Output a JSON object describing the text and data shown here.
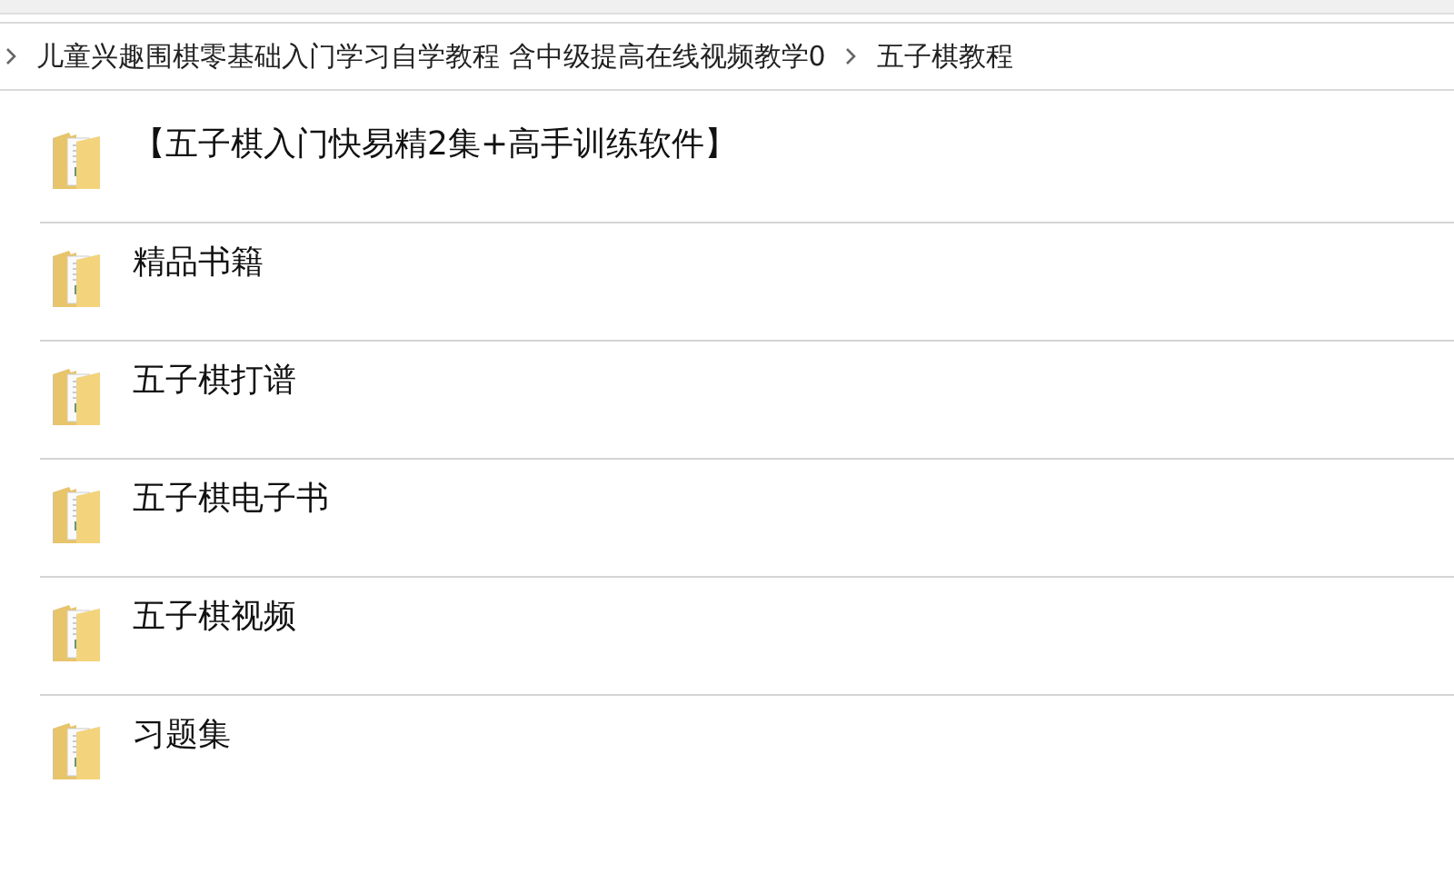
{
  "breadcrumb": [
    {
      "label": "儿童兴趣围棋零基础入门学习自学教程 含中级提高在线视频教学0"
    },
    {
      "label": "五子棋教程"
    }
  ],
  "folders": [
    {
      "name": "【五子棋入门快易精2集+高手训练软件】"
    },
    {
      "name": "精品书籍"
    },
    {
      "name": "五子棋打谱"
    },
    {
      "name": "五子棋电子书"
    },
    {
      "name": "五子棋视频"
    },
    {
      "name": "习题集"
    }
  ]
}
